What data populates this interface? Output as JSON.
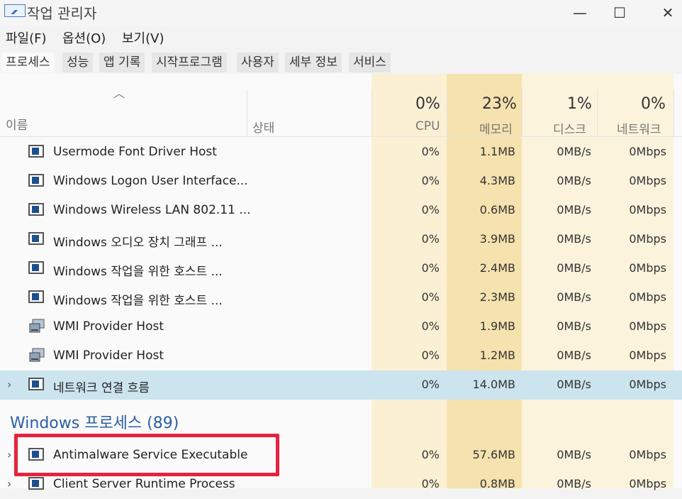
{
  "window": {
    "title": "작업 관리자",
    "minimize": "—",
    "maximize": "☐",
    "close": "✕"
  },
  "menu": [
    "파일(F)",
    "옵션(O)",
    "보기(V)"
  ],
  "tabs": [
    "프로세스",
    "성능",
    "앱 기록",
    "시작프로그램",
    "사용자",
    "세부 정보",
    "서비스"
  ],
  "header": {
    "name": "이름",
    "status": "상태",
    "cpu": {
      "pct": "0%",
      "label": "CPU"
    },
    "memory": {
      "pct": "23%",
      "label": "메모리"
    },
    "disk": {
      "pct": "1%",
      "label": "디스크"
    },
    "network": {
      "pct": "0%",
      "label": "네트워크"
    }
  },
  "rows": [
    {
      "name": "Usermode Font Driver Host",
      "cpu": "0%",
      "mem": "1.1MB",
      "disk": "0MB/s",
      "net": "0Mbps",
      "icon": "window-icon"
    },
    {
      "name": "Windows Logon User Interface...",
      "cpu": "0%",
      "mem": "4.3MB",
      "disk": "0MB/s",
      "net": "0Mbps",
      "icon": "window-icon"
    },
    {
      "name": "Windows Wireless LAN 802.11 ...",
      "cpu": "0%",
      "mem": "0.6MB",
      "disk": "0MB/s",
      "net": "0Mbps",
      "icon": "window-icon"
    },
    {
      "name": "Windows 오디오 장치 그래프 ...",
      "cpu": "0%",
      "mem": "3.9MB",
      "disk": "0MB/s",
      "net": "0Mbps",
      "icon": "window-icon"
    },
    {
      "name": "Windows 작업을 위한 호스트 ...",
      "cpu": "0%",
      "mem": "2.4MB",
      "disk": "0MB/s",
      "net": "0Mbps",
      "icon": "window-icon"
    },
    {
      "name": "Windows 작업을 위한 호스트 ...",
      "cpu": "0%",
      "mem": "2.3MB",
      "disk": "0MB/s",
      "net": "0Mbps",
      "icon": "window-icon"
    },
    {
      "name": "WMI Provider Host",
      "cpu": "0%",
      "mem": "1.9MB",
      "disk": "0MB/s",
      "net": "0Mbps",
      "icon": "wmi-icon"
    },
    {
      "name": "WMI Provider Host",
      "cpu": "0%",
      "mem": "1.2MB",
      "disk": "0MB/s",
      "net": "0Mbps",
      "icon": "wmi-icon"
    },
    {
      "name": "네트워크 연결 흐름",
      "cpu": "0%",
      "mem": "14.0MB",
      "disk": "0MB/s",
      "net": "0Mbps",
      "icon": "window-icon",
      "expand": "›"
    }
  ],
  "group": {
    "title": "Windows 프로세스 (89)"
  },
  "group_rows": [
    {
      "name": "Antimalware Service Executable",
      "cpu": "0%",
      "mem": "57.6MB",
      "disk": "0MB/s",
      "net": "0Mbps",
      "icon": "window-icon",
      "expand": "›"
    },
    {
      "name": "Client Server Runtime Process",
      "cpu": "0%",
      "mem": "0.8MB",
      "disk": "0MB/s",
      "net": "0Mbps",
      "icon": "window-icon",
      "expand": "›"
    }
  ],
  "colors": {
    "cpu_col": "#fbf0d3",
    "mem_col": "#f6e2ae",
    "selected": "#cce4ee",
    "highlight": "#e8223d",
    "group": "#2b5fa5"
  }
}
